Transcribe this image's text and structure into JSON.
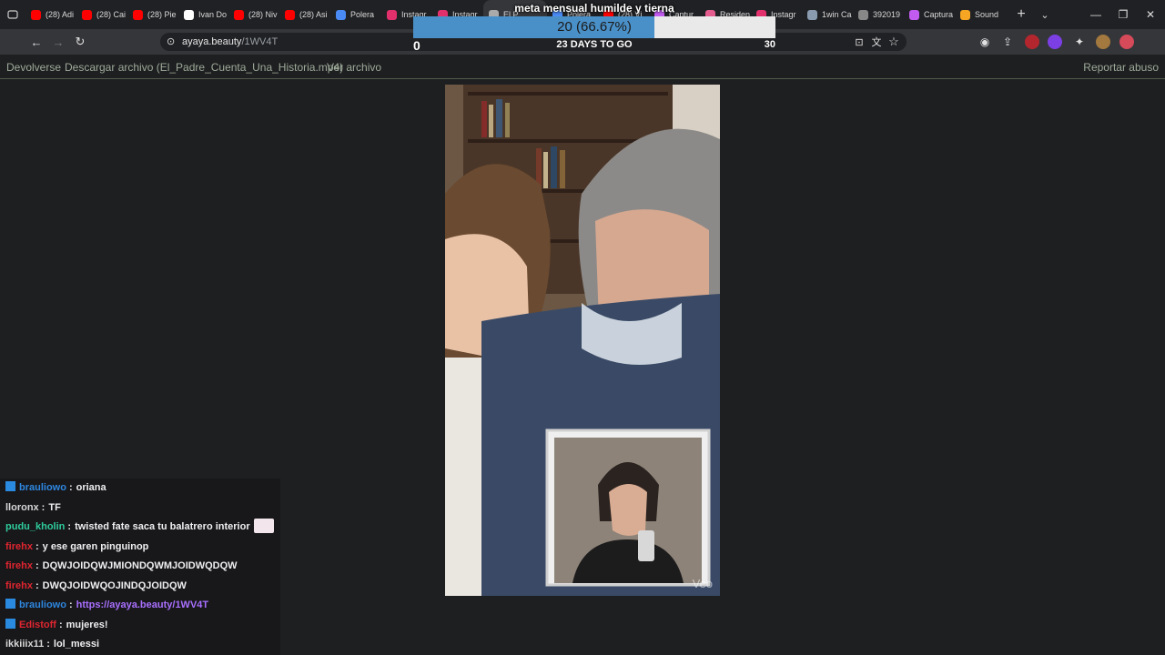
{
  "tabs": [
    {
      "label": "(28) Adi",
      "icon": "youtube-icon",
      "color": "#ff0000"
    },
    {
      "label": "(28) Cai",
      "icon": "youtube-icon",
      "color": "#ff0000"
    },
    {
      "label": "(28) Pie",
      "icon": "youtube-icon",
      "color": "#ff0000"
    },
    {
      "label": "Ivan Do",
      "icon": "tiktok-icon",
      "color": "#ffffff"
    },
    {
      "label": "(28) Niv",
      "icon": "youtube-icon",
      "color": "#ff0000"
    },
    {
      "label": "(28) Asi",
      "icon": "youtube-icon",
      "color": "#ff0000"
    },
    {
      "label": "Polera",
      "icon": "globe-icon",
      "color": "#4a8af4"
    },
    {
      "label": "Instagr",
      "icon": "instagram-icon",
      "color": "#e1306c"
    },
    {
      "label": "Instagr",
      "icon": "instagram-icon",
      "color": "#e1306c"
    },
    {
      "label": "El P",
      "icon": "speaker-icon",
      "color": "#aaaaaa"
    },
    {
      "label": "Polera",
      "icon": "globe-icon",
      "color": "#4a8af4"
    },
    {
      "label": "(28) Vi",
      "icon": "youtube-icon",
      "color": "#ff0000"
    },
    {
      "label": "Captur",
      "icon": "pen-icon",
      "color": "#c25cf0"
    },
    {
      "label": "Residen",
      "icon": "sparkle-icon",
      "color": "#e35c8d"
    },
    {
      "label": "Instagr",
      "icon": "instagram-icon",
      "color": "#e1306c"
    },
    {
      "label": "1win Ca",
      "icon": "card-icon",
      "color": "#8a9bb0"
    },
    {
      "label": "392019",
      "icon": "mountain-icon",
      "color": "#888888"
    },
    {
      "label": "Captura",
      "icon": "pen-icon",
      "color": "#c25cf0"
    },
    {
      "label": "Sound",
      "icon": "sound-icon",
      "color": "#f6a623"
    }
  ],
  "address": {
    "host": "ayaya.beauty",
    "path": "/1WV4T"
  },
  "goal": {
    "title": "meta mensual humilde y tierna",
    "current_label": "20 (66.67%)",
    "fraction": 0.6667,
    "min": "0",
    "days": "23 DAYS TO GO",
    "max": "30",
    "fill_color": "#4a90c8"
  },
  "pagenav": {
    "back": "Devolverse",
    "download": "Descargar archivo (El_Padre_Cuenta_Una_Historia.mp4)",
    "view": "Ver archivo",
    "report": "Reportar abuso"
  },
  "video": {
    "watermark": "Veo"
  },
  "chat": [
    {
      "badge": true,
      "user": "brauliowo",
      "color": "#2e86de",
      "text": "oriana"
    },
    {
      "badge": false,
      "user": "lloronx",
      "color": "#d8d8d8",
      "text": "TF"
    },
    {
      "badge": false,
      "user": "pudu_kholin",
      "color": "#2ecc9a",
      "text": "twisted fate saca tu balatrero interior",
      "emote": true
    },
    {
      "badge": false,
      "user": "firehx",
      "color": "#e0252f",
      "text": "y ese garen pinguinop"
    },
    {
      "badge": false,
      "user": "firehx",
      "color": "#e0252f",
      "text": "DQWJOIDQWJMIONDQWMJOIDWQDQW"
    },
    {
      "badge": false,
      "user": "firehx",
      "color": "#e0252f",
      "text": "DWQJOIDWQOJINDQJOIDQW"
    },
    {
      "badge": true,
      "user": "brauliowo",
      "color": "#2e86de",
      "text": "https://ayaya.beauty/1WV4T",
      "link": true
    },
    {
      "badge": true,
      "user": "Edistoff",
      "color": "#e0252f",
      "text": "mujeres!"
    },
    {
      "badge": false,
      "user": "ikkiiix11",
      "color": "#d8d8d8",
      "text": "lol_messi"
    }
  ],
  "chat_separator": ":"
}
